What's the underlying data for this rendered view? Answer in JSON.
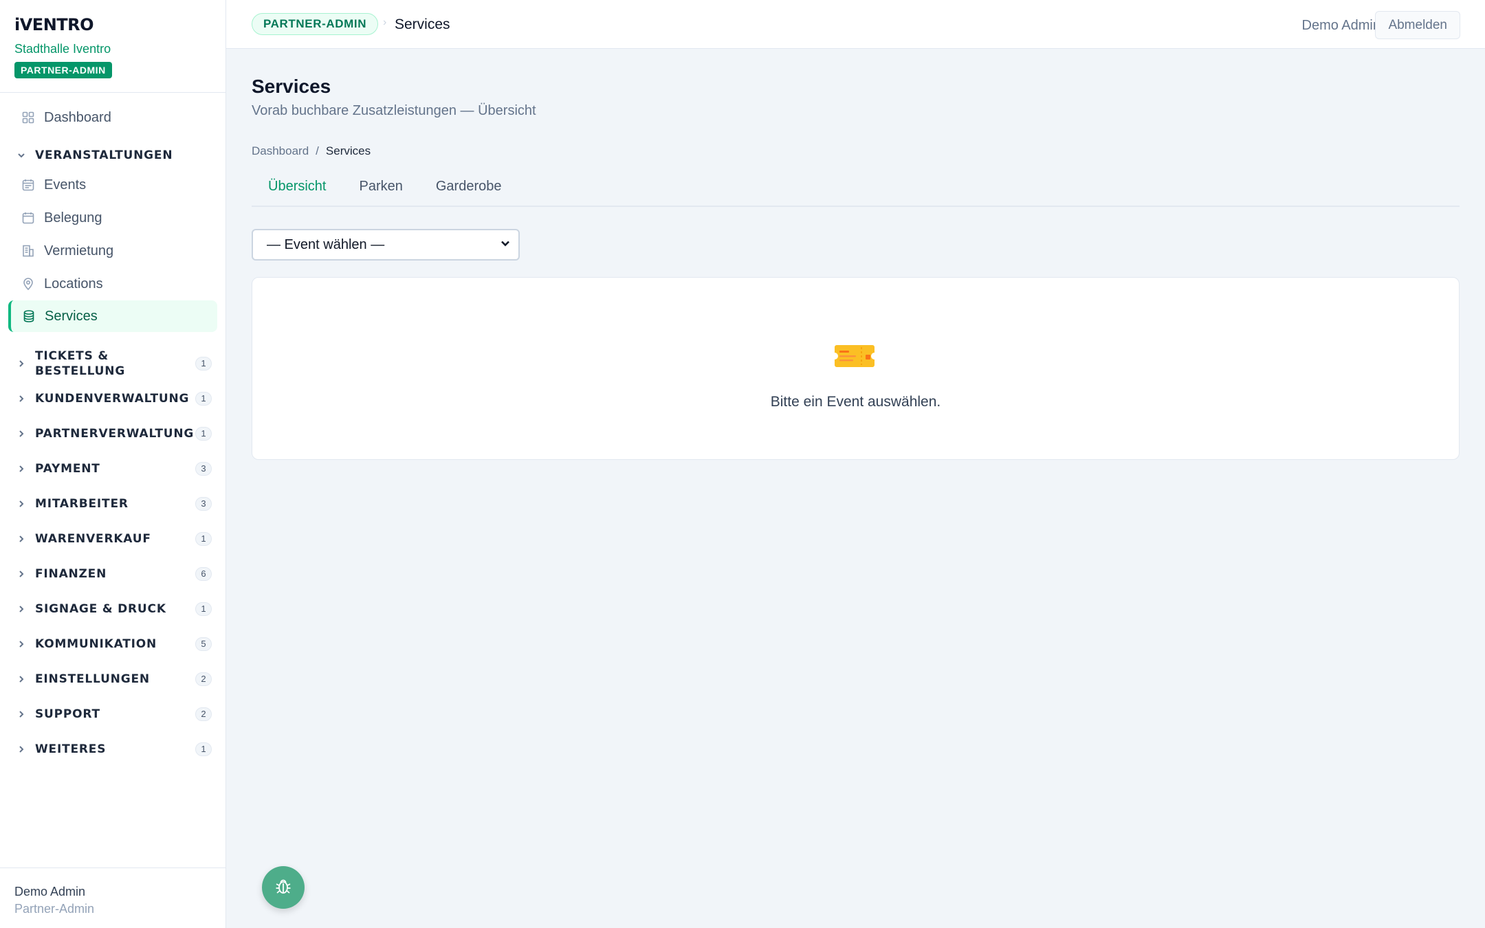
{
  "brand": {
    "logo": "iVENTRO",
    "org": "Stadthalle Iventro",
    "role_badge": "PARTNER-ADMIN"
  },
  "nav": {
    "dashboard": "Dashboard",
    "section_veranstaltungen": "VERANSTALTUNGEN",
    "items": [
      {
        "label": "Events",
        "icon": "calendar-list-icon"
      },
      {
        "label": "Belegung",
        "icon": "calendar-icon"
      },
      {
        "label": "Vermietung",
        "icon": "building-icon"
      },
      {
        "label": "Locations",
        "icon": "map-pin-icon"
      },
      {
        "label": "Services",
        "icon": "database-icon",
        "active": true
      }
    ],
    "groups": [
      {
        "label": "TICKETS & BESTELLUNG",
        "count": "1"
      },
      {
        "label": "KUNDENVERWALTUNG",
        "count": "1"
      },
      {
        "label": "PARTNERVERWALTUNG",
        "count": "1"
      },
      {
        "label": "PAYMENT",
        "count": "3"
      },
      {
        "label": "MITARBEITER",
        "count": "3"
      },
      {
        "label": "WARENVERKAUF",
        "count": "1"
      },
      {
        "label": "FINANZEN",
        "count": "6"
      },
      {
        "label": "SIGNAGE & DRUCK",
        "count": "1"
      },
      {
        "label": "KOMMUNIKATION",
        "count": "5"
      },
      {
        "label": "EINSTELLUNGEN",
        "count": "2"
      },
      {
        "label": "SUPPORT",
        "count": "2"
      },
      {
        "label": "WEITERES",
        "count": "1"
      }
    ]
  },
  "sidebar_footer": {
    "name": "Demo Admin",
    "role": "Partner-Admin"
  },
  "topbar": {
    "badge": "PARTNER-ADMIN",
    "separator": "›",
    "title": "Services",
    "user": "Demo Admin",
    "logout": "Abmelden"
  },
  "page": {
    "title": "Services",
    "subtitle": "Vorab buchbare Zusatzleistungen — Übersicht",
    "breadcrumb": {
      "home": "Dashboard",
      "sep": "/",
      "current": "Services"
    },
    "tabs": [
      {
        "label": "Übersicht",
        "active": true
      },
      {
        "label": "Parken"
      },
      {
        "label": "Garderobe"
      }
    ],
    "event_select": {
      "value": "— Event wählen —"
    },
    "empty_state": {
      "icon": "ticket-icon",
      "text": "Bitte ein Event auswählen."
    }
  },
  "fab": {
    "icon": "bug-icon"
  },
  "colors": {
    "accent": "#059669",
    "active_bg": "#ecfdf5",
    "background": "#f1f5f9",
    "fab": "#4ead8a",
    "ticket": "#fbbf24"
  }
}
